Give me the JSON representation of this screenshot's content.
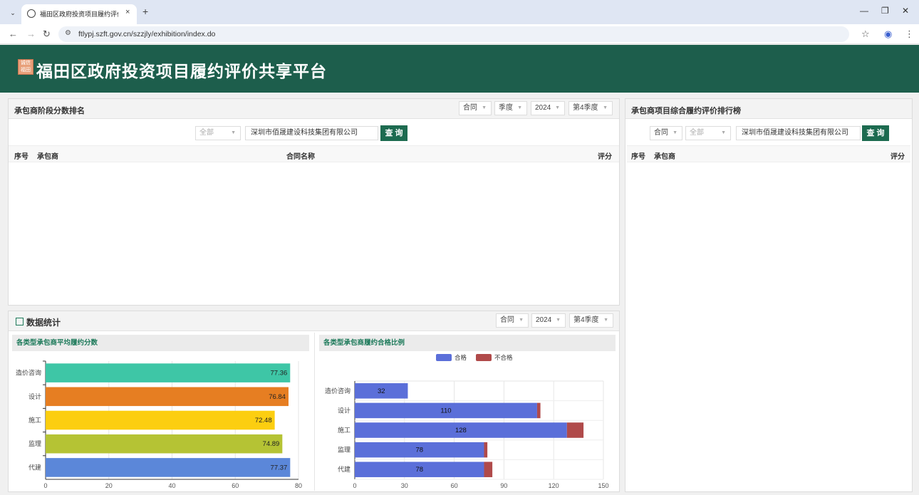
{
  "browser": {
    "tab_title": "福田区政府投资项目履约评价共",
    "url": "ftlypj.szft.gov.cn/szzjly/exhibition/index.do",
    "tab_close": "×",
    "new_tab": "+"
  },
  "header": {
    "title": "福田区政府投资项目履约评价共享平台",
    "logo_text": "诚信福田"
  },
  "stage_ranking": {
    "title": "承包商阶段分数排名",
    "filters": {
      "type": "合同",
      "period": "季度",
      "year": "2024",
      "quarter": "第4季度"
    },
    "search_scope": "全部",
    "search_value": "深圳市佰晟建设科技集团有限公司",
    "search_button": "查 询",
    "columns": {
      "index": "序号",
      "contractor": "承包商",
      "contract": "合同名称",
      "score": "评分"
    }
  },
  "overall_ranking": {
    "title": "承包商项目综合履约评价排行榜",
    "filters": {
      "type": "合同",
      "scope": "全部"
    },
    "search_value": "深圳市佰晟建设科技集团有限公司",
    "search_button": "查 询",
    "columns": {
      "index": "序号",
      "contractor": "承包商",
      "score": "评分"
    }
  },
  "statistics": {
    "title": "数据统计",
    "filters": {
      "type": "合同",
      "year": "2024",
      "quarter": "第4季度"
    },
    "avg_chart_title": "各类型承包商平均履约分数",
    "ratio_chart_title": "各类型承包商履约合格比例"
  },
  "chart_data": [
    {
      "type": "bar",
      "orientation": "horizontal",
      "title": "各类型承包商平均履约分数",
      "categories": [
        "造价咨询",
        "设计",
        "施工",
        "监理",
        "代建"
      ],
      "values": [
        77.36,
        76.84,
        72.48,
        74.89,
        77.37
      ],
      "colors": [
        "#3ec6a6",
        "#e67e22",
        "#fcce10",
        "#b5c334",
        "#5b87d9"
      ],
      "xlim": [
        0,
        80
      ],
      "xticks": [
        0,
        20,
        40,
        60,
        80
      ]
    },
    {
      "type": "bar",
      "orientation": "horizontal",
      "stacked": true,
      "title": "各类型承包商履约合格比例",
      "categories": [
        "造价咨询",
        "设计",
        "施工",
        "监理",
        "代建"
      ],
      "series": [
        {
          "name": "合格",
          "color": "#5b6fd9",
          "values": [
            32,
            110,
            128,
            78,
            78
          ]
        },
        {
          "name": "不合格",
          "color": "#b04a4a",
          "values": [
            0,
            2,
            10,
            2,
            5
          ]
        }
      ],
      "xlim": [
        0,
        150
      ],
      "xticks": [
        0,
        30,
        60,
        90,
        120,
        150
      ],
      "legend": "top-center"
    }
  ]
}
